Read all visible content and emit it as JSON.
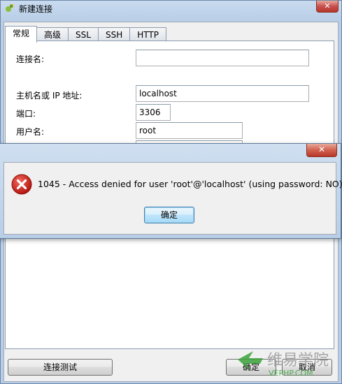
{
  "window": {
    "title": "新建连接",
    "close_glyph": "✕",
    "tabs": [
      {
        "label": "常规",
        "active": true
      },
      {
        "label": "高级"
      },
      {
        "label": "SSL"
      },
      {
        "label": "SSH"
      },
      {
        "label": "HTTP"
      }
    ],
    "form": {
      "connection_name_label": "连接名:",
      "connection_name_value": "",
      "host_label": "主机名或 IP 地址:",
      "host_value": "localhost",
      "port_label": "端口:",
      "port_value": "3306",
      "user_label": "用户名:",
      "user_value": "root"
    },
    "buttons": {
      "test_connection": "连接测试",
      "ok": "确定",
      "cancel": "取消"
    }
  },
  "error_dialog": {
    "close_glyph": "✕",
    "message": "1045 - Access denied for user 'root'@'localhost' (using password: NO)",
    "ok_label": "确定",
    "icon": "error-icon"
  },
  "watermark": {
    "text_cn": "维易学院",
    "text_en": "VEPHP.COM"
  },
  "colors": {
    "error_red": "#d8201c",
    "watermark_green": "#3aa23a",
    "watermark_gray": "#9a9a9a"
  }
}
